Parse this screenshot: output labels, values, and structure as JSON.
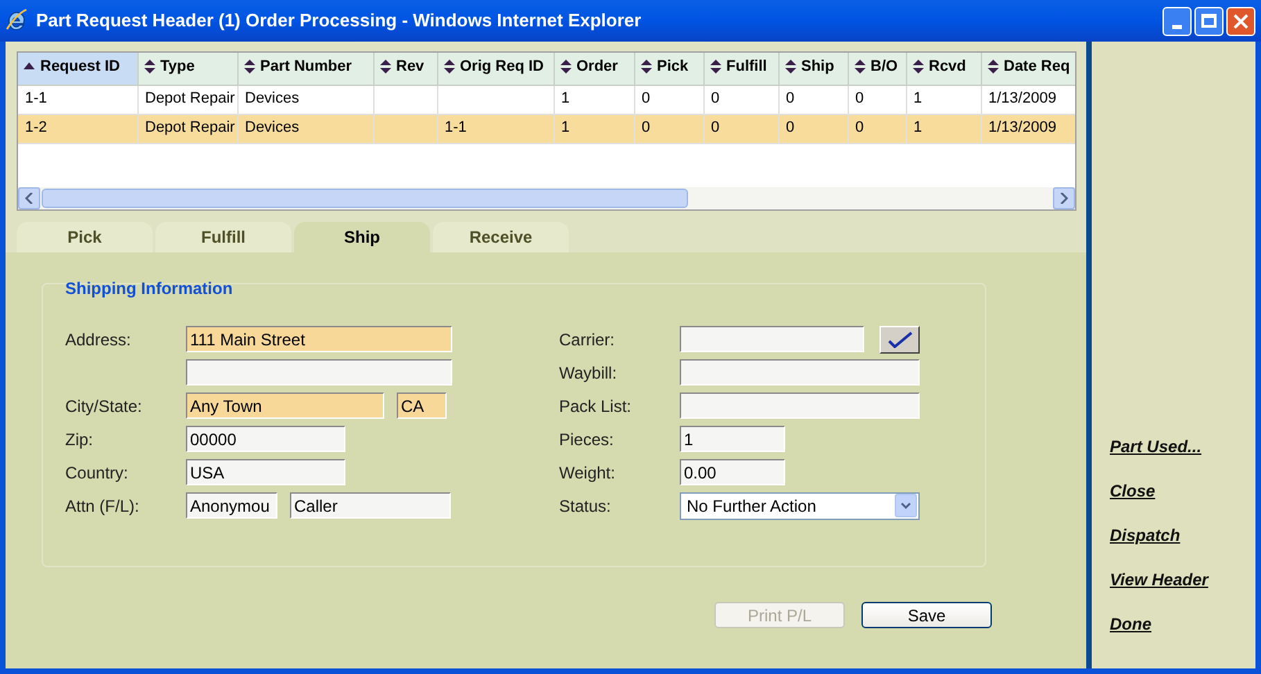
{
  "window": {
    "title": "Part Request Header (1) Order Processing - Windows Internet Explorer"
  },
  "grid": {
    "columns": [
      {
        "label": "Request ID",
        "sorted": true
      },
      {
        "label": "Type",
        "sorted": false
      },
      {
        "label": "Part Number",
        "sorted": false
      },
      {
        "label": "Rev",
        "sorted": false
      },
      {
        "label": "Orig Req ID",
        "sorted": false
      },
      {
        "label": "Order",
        "sorted": false
      },
      {
        "label": "Pick",
        "sorted": false
      },
      {
        "label": "Fulfill",
        "sorted": false
      },
      {
        "label": "Ship",
        "sorted": false
      },
      {
        "label": "B/O",
        "sorted": false
      },
      {
        "label": "Rcvd",
        "sorted": false
      },
      {
        "label": "Date Req",
        "sorted": false
      }
    ],
    "rows": [
      {
        "selected": false,
        "cells": [
          "1-1",
          "Depot Repair",
          "Devices",
          "",
          "",
          "1",
          "0",
          "0",
          "0",
          "0",
          "1",
          "1/13/2009"
        ]
      },
      {
        "selected": true,
        "cells": [
          "1-2",
          "Depot Repair",
          "Devices",
          "",
          "1-1",
          "1",
          "0",
          "0",
          "0",
          "0",
          "1",
          "1/13/2009"
        ]
      }
    ]
  },
  "tabs": [
    {
      "label": "Pick",
      "selected": false
    },
    {
      "label": "Fulfill",
      "selected": false
    },
    {
      "label": "Ship",
      "selected": true
    },
    {
      "label": "Receive",
      "selected": false
    }
  ],
  "section": {
    "title": "Shipping Information"
  },
  "left_fields": [
    {
      "label": "Address:",
      "kind": "input",
      "inputs": [
        {
          "value": "111 Main Street",
          "highlighted": true
        }
      ]
    },
    {
      "kind": "input",
      "inputs": [
        {
          "highlighted": false
        }
      ]
    },
    {
      "label": "City/State:",
      "kind": "input",
      "inputs": [
        {
          "value": "Any Town",
          "highlighted": true
        },
        {
          "value": "CA",
          "highlighted": true
        }
      ]
    },
    {
      "label": "Zip:",
      "kind": "input",
      "inputs": [
        {
          "value": "00000",
          "highlighted": false
        }
      ]
    },
    {
      "label": "Country:",
      "kind": "input",
      "inputs": [
        {
          "value": "USA",
          "highlighted": false
        }
      ]
    },
    {
      "label": "Attn (F/L):",
      "kind": "input",
      "inputs": [
        {
          "value": "Anonymou",
          "highlighted": false
        },
        {
          "value": "Caller",
          "highlighted": false
        }
      ]
    }
  ],
  "right_fields": [
    {
      "label": "Carrier:",
      "kind": "lookup",
      "inputs": [
        {
          "highlighted": false
        }
      ]
    },
    {
      "label": "Waybill:",
      "kind": "input",
      "inputs": [
        {
          "highlighted": false
        }
      ]
    },
    {
      "label": "Pack List:",
      "kind": "input",
      "inputs": [
        {
          "highlighted": false
        }
      ]
    },
    {
      "label": "Pieces:",
      "kind": "input",
      "inputs": [
        {
          "value": "1",
          "highlighted": false
        }
      ]
    },
    {
      "label": "Weight:",
      "kind": "input",
      "inputs": [
        {
          "value": "0.00",
          "highlighted": false
        }
      ]
    },
    {
      "label": "Status:",
      "kind": "select",
      "value": "No Further Action"
    }
  ],
  "buttons": [
    {
      "label": "Print P/L",
      "disabled": true
    },
    {
      "label": "Save",
      "disabled": false
    }
  ],
  "side_links": [
    "Part Used...",
    "Close",
    "Dispatch",
    "View Header",
    "Done"
  ]
}
